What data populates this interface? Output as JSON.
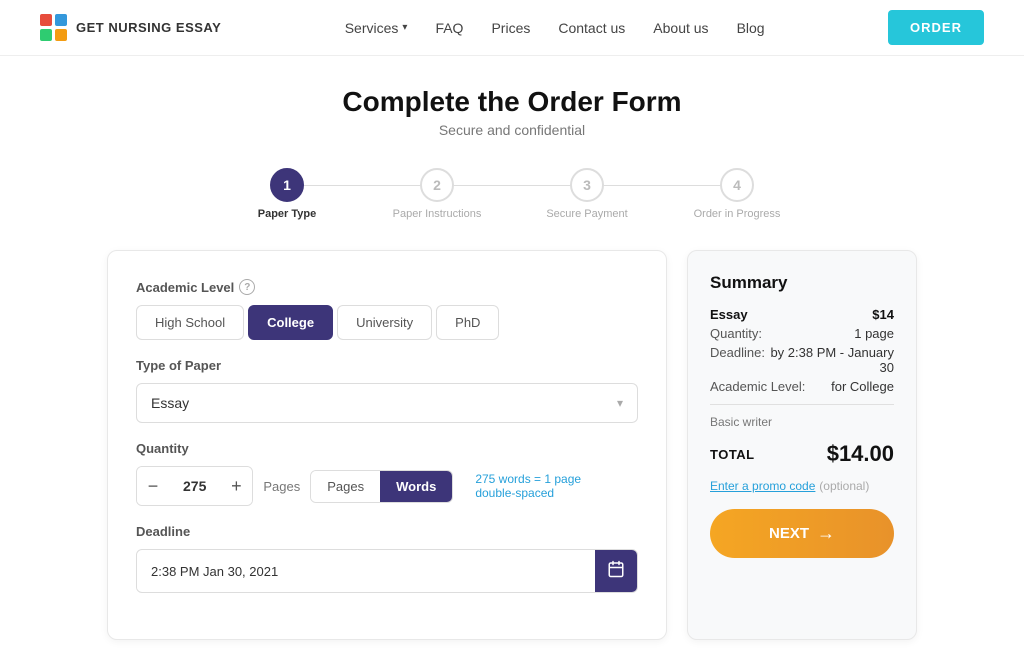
{
  "header": {
    "logo_text": "GET NURSING ESSAY",
    "nav": [
      {
        "label": "Services",
        "has_dropdown": true
      },
      {
        "label": "FAQ"
      },
      {
        "label": "Prices"
      },
      {
        "label": "Contact us"
      },
      {
        "label": "About us"
      },
      {
        "label": "Blog"
      }
    ],
    "order_button": "ORDER"
  },
  "hero": {
    "title": "Complete the Order Form",
    "subtitle": "Secure and confidential"
  },
  "stepper": {
    "steps": [
      {
        "number": "1",
        "label": "Paper Type",
        "active": true
      },
      {
        "number": "2",
        "label": "Paper Instructions",
        "active": false
      },
      {
        "number": "3",
        "label": "Secure Payment",
        "active": false
      },
      {
        "number": "4",
        "label": "Order in Progress",
        "active": false
      }
    ]
  },
  "form": {
    "academic_level_label": "Academic Level",
    "levels": [
      {
        "label": "High School",
        "active": false
      },
      {
        "label": "College",
        "active": true
      },
      {
        "label": "University",
        "active": false
      },
      {
        "label": "PhD",
        "active": false
      }
    ],
    "type_of_paper_label": "Type of Paper",
    "paper_type_value": "Essay",
    "quantity_label": "Quantity",
    "quantity_value": "275",
    "pages_label": "Pages",
    "words_label": "Words",
    "qty_note_line1": "275 words = 1 page",
    "qty_note_line2": "double-spaced",
    "deadline_label": "Deadline",
    "deadline_value": "2:38 PM Jan 30, 2021"
  },
  "summary": {
    "title": "Summary",
    "essay_label": "Essay",
    "essay_price": "$14",
    "quantity_label": "Quantity:",
    "quantity_value": "1 page",
    "deadline_label": "Deadline:",
    "deadline_value": "by 2:38 PM - January 30",
    "academic_level_label": "Academic Level:",
    "academic_level_value": "for College",
    "writer_note": "Basic writer",
    "total_label": "TOTAL",
    "total_value": "$14.00",
    "promo_link": "Enter a promo code",
    "promo_optional": "(optional)",
    "next_button": "NEXT"
  },
  "icons": {
    "chevron_down": "▾",
    "minus": "−",
    "plus": "+",
    "calendar": "📅",
    "arrow_right": "→"
  }
}
